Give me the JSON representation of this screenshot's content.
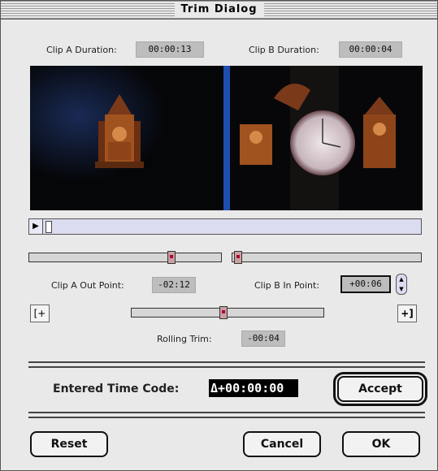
{
  "window": {
    "title": "Trim Dialog"
  },
  "header": {
    "clip_a_duration_label": "Clip A Duration:",
    "clip_a_duration": "00:00:13",
    "clip_b_duration_label": "Clip B Duration:",
    "clip_b_duration": "00:00:04"
  },
  "trim": {
    "clip_a_out_label": "Clip A Out Point:",
    "clip_a_out": "-02:12",
    "clip_b_in_label": "Clip B In Point:",
    "clip_b_in": "+00:06",
    "rolling_trim_label": "Rolling Trim:",
    "rolling_trim": "-00:04"
  },
  "entry": {
    "label": "Entered Time Code:",
    "value": "Δ+00:00:00",
    "accept": "Accept"
  },
  "footer": {
    "reset": "Reset",
    "cancel": "Cancel",
    "ok": "OK"
  },
  "colors": {
    "split_line": "#1e4fb0",
    "tc_box": "#bdbdbd"
  }
}
